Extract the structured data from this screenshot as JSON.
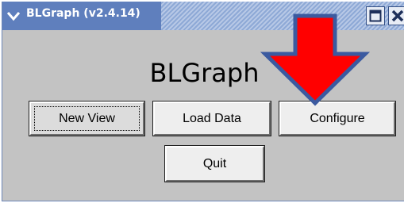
{
  "window": {
    "title": "BLGraph (v2.4.14)",
    "colors": {
      "titlebar": "#5f7fbd",
      "background": "#c3c3c3",
      "button_face": "#eeeeee",
      "annotation_arrow": "#ff0000",
      "annotation_arrow_outline": "#3b5aa0"
    }
  },
  "main": {
    "app_title": "BLGraph",
    "buttons": {
      "new_view": "New View",
      "load_data": "Load Data",
      "configure": "Configure",
      "quit": "Quit"
    }
  },
  "icons": {
    "window_menu": "chevron-down-icon",
    "maximize": "maximize-icon",
    "close": "close-icon",
    "annotation": "arrow-down-icon"
  }
}
